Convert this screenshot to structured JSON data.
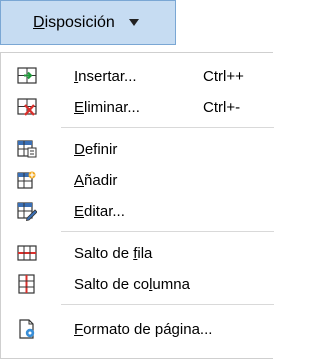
{
  "menu_button": {
    "label_prefix": "",
    "label_underlined": "D",
    "label_rest": "isposición"
  },
  "items": [
    {
      "u": "I",
      "rest": "nsertar...",
      "shortcut": "Ctrl++",
      "icon": "insert-table-icon"
    },
    {
      "u": "E",
      "rest": "liminar...",
      "shortcut": "Ctrl+-",
      "icon": "delete-table-icon"
    },
    {
      "u": "D",
      "rest": "efinir",
      "shortcut": "",
      "icon": "define-range-icon"
    },
    {
      "u": "A",
      "rest": "ñadir",
      "shortcut": "",
      "icon": "add-icon"
    },
    {
      "u": "E",
      "rest": "ditar...",
      "shortcut": "",
      "icon": "edit-icon"
    },
    {
      "pre": "Salto de ",
      "u": "f",
      "rest": "ila",
      "shortcut": "",
      "icon": "row-break-icon"
    },
    {
      "pre": "Salto de co",
      "u": "l",
      "rest": "umna",
      "shortcut": "",
      "icon": "column-break-icon"
    },
    {
      "pre": "",
      "u": "F",
      "rest": "ormato de página...",
      "shortcut": "",
      "icon": "page-format-icon"
    }
  ],
  "colors": {
    "button_bg": "#c6dcf2",
    "button_border": "#7aa7d4",
    "icon_blue": "#3a6fb5",
    "icon_red": "#d9302c"
  }
}
